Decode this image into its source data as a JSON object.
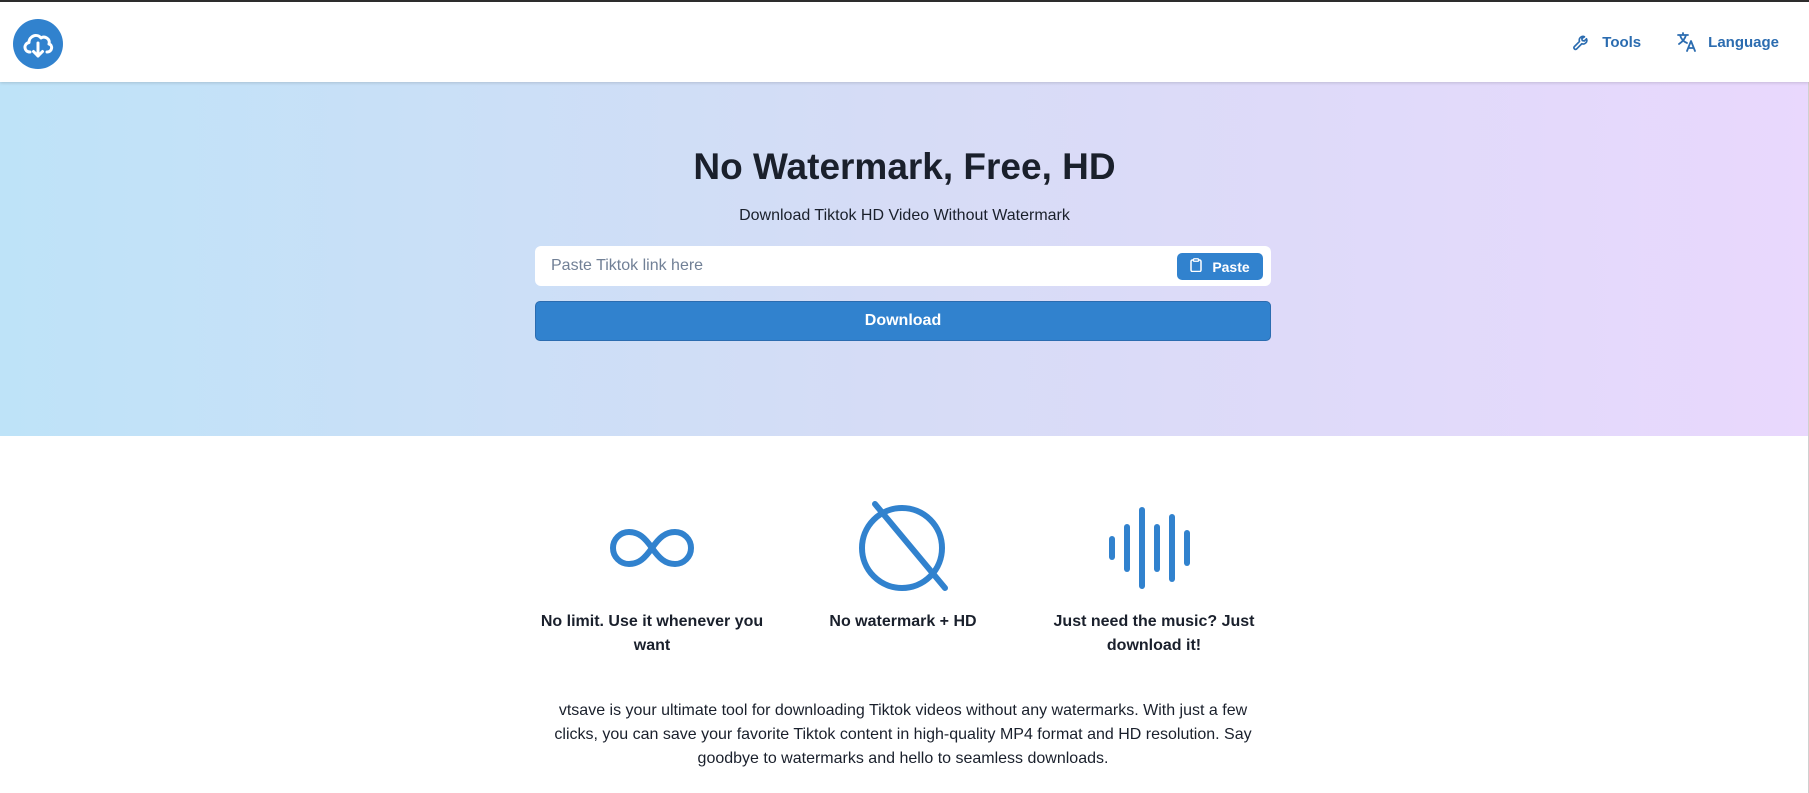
{
  "header": {
    "logo_icon": "cloud-download-icon",
    "nav": [
      {
        "label": "Tools",
        "icon": "wrench-icon"
      },
      {
        "label": "Language",
        "icon": "translate-icon"
      }
    ]
  },
  "hero": {
    "title": "No Watermark, Free, HD",
    "subtitle": "Download Tiktok HD Video Without Watermark",
    "input_placeholder": "Paste Tiktok link here",
    "input_value": "",
    "paste_label": "Paste",
    "paste_icon": "clipboard-icon",
    "download_label": "Download"
  },
  "features": [
    {
      "icon": "infinity-icon",
      "label": "No limit. Use it whenever you want"
    },
    {
      "icon": "no-symbol-icon",
      "label": "No watermark + HD"
    },
    {
      "icon": "sound-wave-icon",
      "label": "Just need the music? Just download it!"
    }
  ],
  "description": "vtsave is your ultimate tool for downloading Tiktok videos without any watermarks. With just a few clicks, you can save your favorite Tiktok content in high-quality MP4 format and HD resolution. Say goodbye to watermarks and hello to seamless downloads.",
  "colors": {
    "accent": "#3182ce",
    "accent_text": "#2b6cb0",
    "hero_gradient_start": "#bee3f8",
    "hero_gradient_end": "#e9d8fd",
    "text": "#1a202c"
  }
}
